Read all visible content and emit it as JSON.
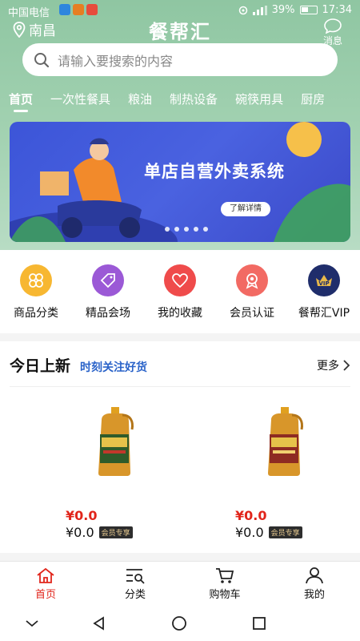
{
  "status_bar": {
    "carrier": "中国电信",
    "battery": "39%",
    "time": "17:34"
  },
  "header": {
    "location": "南昌",
    "title": "餐帮汇",
    "message_label": "消息"
  },
  "search": {
    "placeholder": "请输入要搜索的内容"
  },
  "categories": [
    {
      "label": "首页",
      "active": true
    },
    {
      "label": "一次性餐具",
      "active": false
    },
    {
      "label": "粮油",
      "active": false
    },
    {
      "label": "制热设备",
      "active": false
    },
    {
      "label": "碗筷用具",
      "active": false
    },
    {
      "label": "厨房",
      "active": false
    }
  ],
  "banner": {
    "title": "单店自营外卖系统",
    "button": "了解详情",
    "slide_count": 5
  },
  "quick_links": [
    {
      "label": "商品分类",
      "icon": "clover-icon",
      "color": "#f7b731"
    },
    {
      "label": "精品会场",
      "icon": "tag-icon",
      "color": "#9b59d6"
    },
    {
      "label": "我的收藏",
      "icon": "heart-icon",
      "color": "#ef4b4b"
    },
    {
      "label": "会员认证",
      "icon": "badge-icon",
      "color": "#f26a63"
    },
    {
      "label": "餐帮汇VIP",
      "icon": "vip-icon",
      "color": "#1f2d6b"
    }
  ],
  "new_today": {
    "title": "今日上新",
    "subtitle": "时刻关注好货",
    "more": "更多",
    "products": [
      {
        "price": "¥0.0",
        "vip_price": "¥0.0",
        "vip_tag": "会员专享",
        "label_color": "#2f5b2a"
      },
      {
        "price": "¥0.0",
        "vip_price": "¥0.0",
        "vip_tag": "会员专享",
        "label_color": "#8e2b22"
      }
    ]
  },
  "tabbar": [
    {
      "label": "首页",
      "icon": "home-icon",
      "active": true
    },
    {
      "label": "分类",
      "icon": "category-icon",
      "active": false
    },
    {
      "label": "购物车",
      "icon": "cart-icon",
      "active": false
    },
    {
      "label": "我的",
      "icon": "user-icon",
      "active": false
    }
  ],
  "colors": {
    "header_green": "#9ccca9",
    "accent_red": "#e1251b",
    "subtitle_blue": "#2a63c9"
  }
}
